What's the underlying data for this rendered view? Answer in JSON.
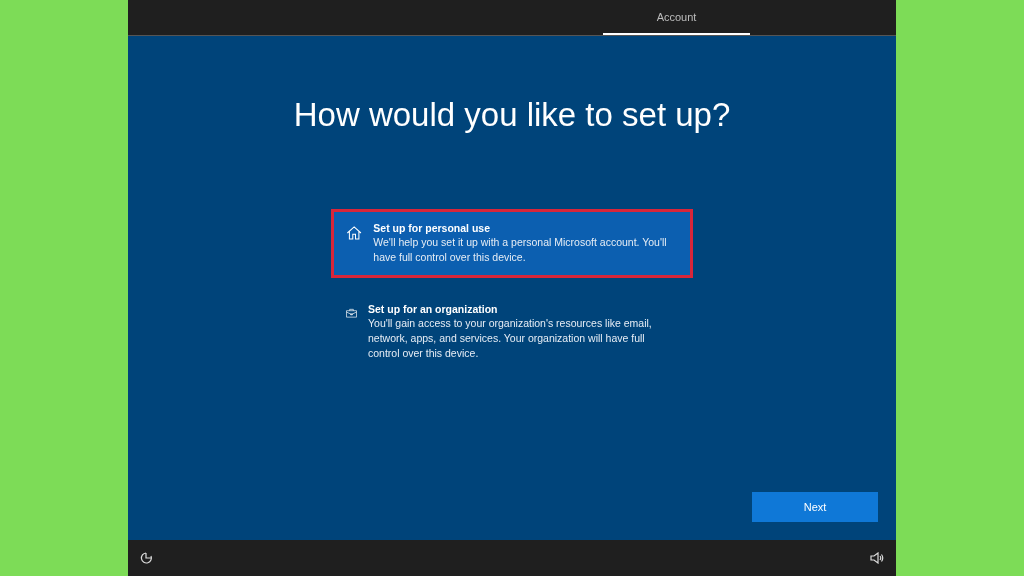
{
  "top_bar": {
    "tabs": [
      {
        "label": "Account",
        "selected": true
      }
    ]
  },
  "heading": "How would you like to set up?",
  "options": [
    {
      "kind": "home",
      "title": "Set up for personal use",
      "description": "We'll help you set it up with a personal Microsoft account. You'll have full control over this device.",
      "selected": true
    },
    {
      "kind": "briefcase",
      "title": "Set up for an organization",
      "description": "You'll gain access to your organization's resources like email, network, apps, and services. Your organization will have full control over this device.",
      "selected": false
    }
  ],
  "next_button": "Next"
}
